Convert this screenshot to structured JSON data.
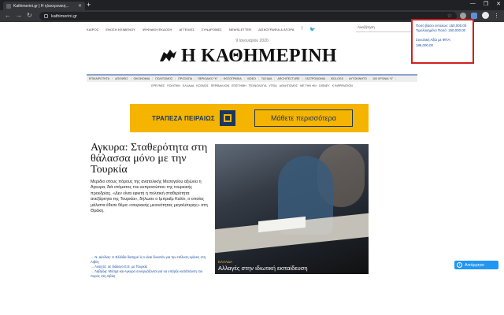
{
  "browser": {
    "tab_title": "Kathimerini.gr | Η ηλεκτρονική...",
    "url": "kathimerini.gr",
    "new_tab_symbol": "+",
    "window_controls": [
      "—",
      "❐",
      "✕"
    ]
  },
  "topnav": {
    "items": [
      "ΚΑΙΡΟΣ",
      "ΕΝΟΣΗ ΚΕΙΜΕΝΟΥ",
      "ΨΗΦΙΑΚΗ ΕΚΔΟΣΗ",
      "ΑΓΓΕΛΙΕΣ",
      "ΣΥΝΔΡΟΜΕΣ",
      "NEWSLETTER",
      "ΔΙΣΚΟΓΡΑΦΙΑ & ΑΓΟΡΑ"
    ],
    "search_placeholder": "Αναζήτηση"
  },
  "date": "9 Ιανουαρίου 2020",
  "logo": "Η ΚΑΘΗΜΕΡΙΝΗ",
  "section_nav": [
    "ΕΠΙΚΑΙΡΟΤΗΤΑ",
    "ΑΠΟΨΕΙΣ",
    "ΟΙΚΟΝΟΜΙΑ",
    "ΠΟΛΙΤΙΣΜΟΣ",
    "ΠΡΟΣΩΠΑ",
    "ΠΕΡΙΟΔΙΚΟ \"Κ\"",
    "ΦΩΤΟΓΡΑΦΙΑ",
    "VIDEO",
    "ΤΑΞΙΔΙΑ",
    "ARCHITECTURE",
    "ΓΑΣΤΡΟΝΟΜΙΑ",
    "KIDLOGS",
    "ΑΥΤΟΚΙΝΗΤΟ",
    "100 ΧΡΟΝΙΑ \"Κ\""
  ],
  "sub_nav": [
    "ΕΡΕΥΝΕΣ",
    "ΠΟΛΙΤΙΚΗ",
    "ΕΛΛΑΔΑ",
    "ΚΟΣΜΟΣ",
    "ΠΕΡΙΒΑΛΛΟΝ",
    "ΕΠΙΣΤΗΜΗ",
    "ΤΕΧΝΟΛΟΓΙΑ",
    "ΥΓΕΙΑ",
    "ΑΘΛΗΤΙΣΜΟΣ",
    "ΜΕ ΤΗΝ «Κ»",
    "DISNEY",
    "Κ INSPIRATION"
  ],
  "banner": {
    "bank_name": "ΤΡΑΠΕΖΑ ΠΕΙΡΑΙΩΣ",
    "cta": "Μάθετε περισσότερα"
  },
  "article": {
    "headline": "Αγκυρα: Σταθερότητα στη θάλασσα μόνο με την Τουρκία",
    "lead": "Μεριδιο στους πόρους της ανατολικής Μεσογείου αξιώνει η Αγκυρα, διά στόματος του εκπροσώπου της τουρκικής προεδρίας. «Δεν είναι εφικτή η πολιτική σταθερότητα ανεξάρτητα της Τουρκία», δήλωσε ο Ιμπραΐμ Καλίν, ο οποίος μάλιστα έθεσε θέμα «τουρκικής μειονότητας μεγαλύτερης» στη Θράκη.",
    "related": [
      "→ Ν. Δένδιας: Η Ελλάδα διατηρεί ό,τι είναι δυνατόν για την επίλυση κρίσεις στη Λιβύη",
      "→ Ανοιχτό: σε διάλογο Ε.Ε. με Τουρκία",
      "→ Λαβρόφ: Μόσχα και Αγκυρα συνεργάζονται για να υπάρξει κατάπαυση του πυρός στη Λιβύη"
    ]
  },
  "photo": {
    "category": "ΕΛΛΑΔΑ",
    "caption": "Αλλαγές στην ιδιωτική εκπαίδευση"
  },
  "popup": {
    "lines": [
      "Ποσό βάσει εντολών: 150,000.00",
      "Τιμολογημένο Ποσό: 150,000.00",
      "",
      "Συνολική Αξία με ΦΠΑ:",
      "186,000.00"
    ]
  },
  "apo_button": {
    "label": "Απόρρητο"
  }
}
